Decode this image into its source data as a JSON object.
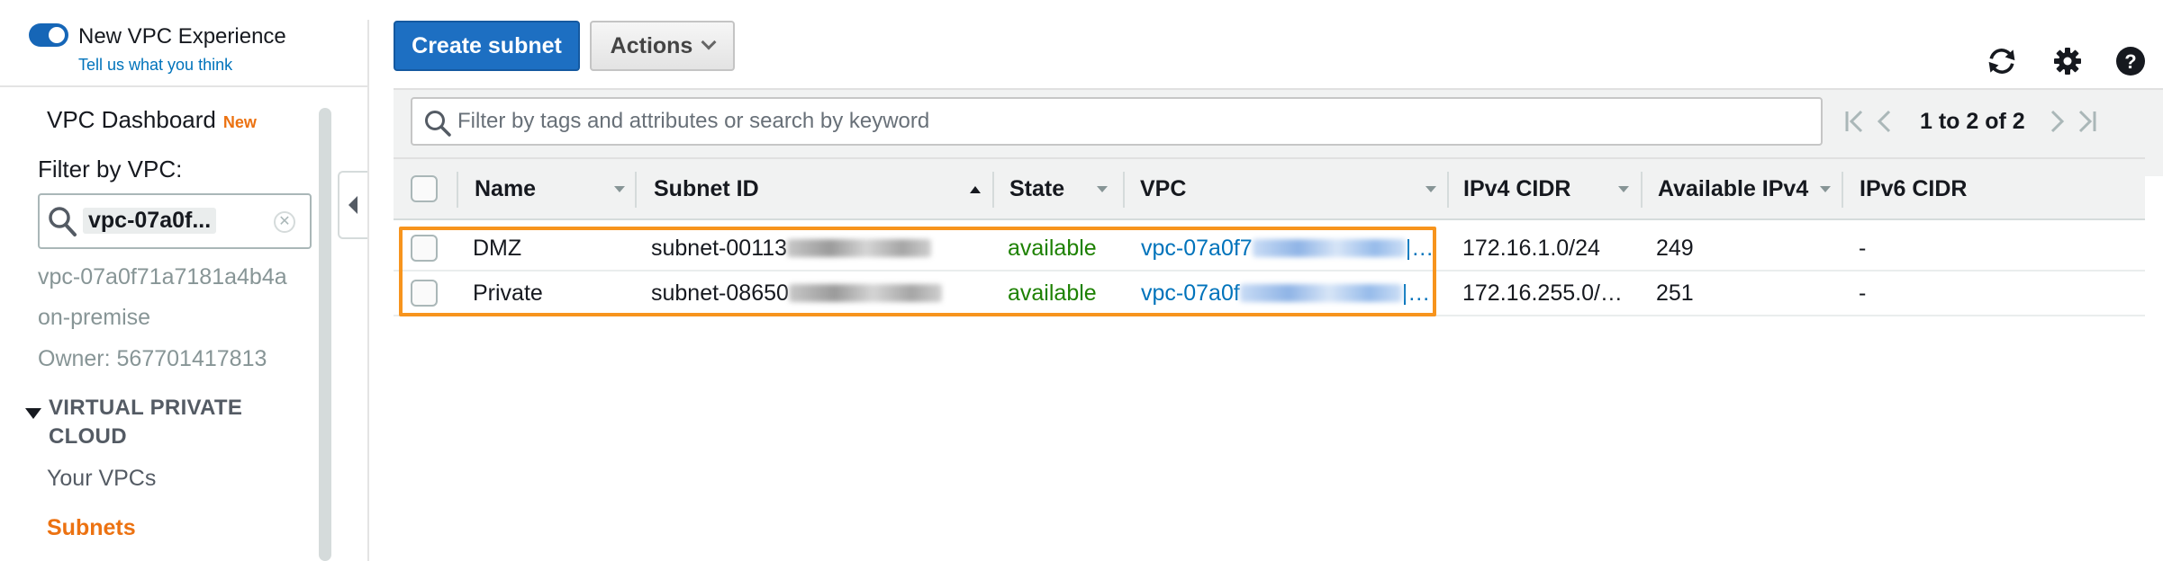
{
  "sidebar": {
    "experience_toggle_label": "New VPC Experience",
    "feedback_link": "Tell us what you think",
    "dashboard_label": "VPC Dashboard",
    "new_badge": "New",
    "filter_label": "Filter by VPC:",
    "filter_value": "vpc-07a0f...",
    "vpc_id": "vpc-07a0f71a7181a4b4a",
    "vpc_name": "on-premise",
    "vpc_owner": "Owner: 567701417813",
    "section_title_line1": "VIRTUAL PRIVATE",
    "section_title_line2": "CLOUD",
    "items": [
      {
        "label": "Your VPCs",
        "active": false
      },
      {
        "label": "Subnets",
        "active": true
      }
    ]
  },
  "toolbar": {
    "create_label": "Create subnet",
    "actions_label": "Actions",
    "icons": [
      "refresh-icon",
      "gear-icon",
      "help-icon"
    ]
  },
  "search": {
    "placeholder": "Filter by tags and attributes or search by keyword"
  },
  "pagination": {
    "text": "1 to 2 of 2"
  },
  "table": {
    "columns": [
      "Name",
      "Subnet ID",
      "State",
      "VPC",
      "IPv4 CIDR",
      "Available IPv4",
      "IPv6 CIDR"
    ],
    "rows": [
      {
        "name": "DMZ",
        "subnet_id": "subnet-00113",
        "state": "available",
        "vpc": "vpc-07a0f7",
        "vpc_suffix": "|…",
        "ipv4_cidr": "172.16.1.0/24",
        "available_ipv4": "249",
        "ipv6_cidr": "-"
      },
      {
        "name": "Private",
        "subnet_id": "subnet-08650",
        "state": "available",
        "vpc": "vpc-07a0f",
        "vpc_suffix": "|…",
        "ipv4_cidr": "172.16.255.0/…",
        "available_ipv4": "251",
        "ipv6_cidr": "-"
      }
    ]
  },
  "colors": {
    "primary": "#1d6fc2",
    "accent_orange": "#ec7211",
    "highlight": "#f7941d",
    "state_green": "#1d8102",
    "link_blue": "#0073bb"
  }
}
